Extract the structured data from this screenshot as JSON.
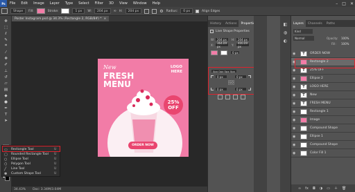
{
  "menubar": {
    "logo": "Ps",
    "items": [
      "File",
      "Edit",
      "Image",
      "Layer",
      "Type",
      "Select",
      "Filter",
      "3D",
      "View",
      "Window",
      "Help"
    ]
  },
  "options": {
    "shape": "Shape",
    "fill": "Fill:",
    "stroke": "Stroke:",
    "stroke_size": "1 px",
    "w_label": "W:",
    "w_value": "204 px",
    "h_label": "H:",
    "h_value": "204 px",
    "radius_label": "Radius:",
    "radius_value": "0 px",
    "align_edges": "Align Edges"
  },
  "document": {
    "tab_label": "Poster Instagram.psd @ 34.3% (Rectangle 2, RGB/8#) *"
  },
  "artwork": {
    "new": "New",
    "fresh": "FRESH",
    "menu": "MENU",
    "logo_line1": "LOGO",
    "logo_line2": "HERE",
    "discount": "25%",
    "off": "OFF",
    "order_now": "ORDER NOW"
  },
  "status": {
    "zoom": "34.43%",
    "doc": "Doc: 3.34M/3.04M"
  },
  "tool_popup": [
    {
      "icon": "rect",
      "label": "Rectangle Tool",
      "key": "U"
    },
    {
      "icon": "rrect",
      "label": "Rounded Rectangle Tool",
      "key": "U"
    },
    {
      "icon": "ellipse",
      "label": "Ellipse Tool",
      "key": "U"
    },
    {
      "icon": "polygon",
      "label": "Polygon Tool",
      "key": "U"
    },
    {
      "icon": "line",
      "label": "Line Tool",
      "key": "U"
    },
    {
      "icon": "custom",
      "label": "Custom Shape Tool",
      "key": "U"
    }
  ],
  "panel": {
    "tabs": [
      "History",
      "Actions",
      "Properties"
    ],
    "title": "Live Shape Properties",
    "w": "204 px",
    "h": "204 px",
    "x": "364.09 px",
    "y": "400.09 px",
    "stroke": "0 px",
    "corner_summary": "0px 0px 0px 0px",
    "tl": "0 px",
    "tr": "0 px",
    "bl": "0 px",
    "br": "0 px"
  },
  "layers": {
    "tabs": [
      "Layers",
      "Channels",
      "Paths"
    ],
    "kind": "Kind",
    "mode": "Normal",
    "opacity_label": "Opacity:",
    "opacity": "100%",
    "fill_label": "Fill:",
    "fill": "100%",
    "items": [
      {
        "name": "ORDER NOW",
        "thumb": "T",
        "pink": false,
        "selected": false
      },
      {
        "name": "Rectangle 2",
        "thumb": "",
        "pink": true,
        "selected": true
      },
      {
        "name": "25% OFF",
        "thumb": "T",
        "pink": false,
        "selected": false
      },
      {
        "name": "Ellipse 2",
        "thumb": "",
        "pink": true,
        "selected": false
      },
      {
        "name": "LOGO HERE",
        "thumb": "T",
        "pink": false,
        "selected": false
      },
      {
        "name": "New",
        "thumb": "T",
        "pink": false,
        "selected": false
      },
      {
        "name": "FRESH MENU",
        "thumb": "T",
        "pink": false,
        "selected": false
      },
      {
        "name": "Rectangle 1",
        "thumb": "",
        "pink": false,
        "selected": false
      },
      {
        "name": "Image",
        "thumb": "",
        "pink": true,
        "selected": false
      },
      {
        "name": "Compound Shape",
        "thumb": "",
        "pink": false,
        "selected": false
      },
      {
        "name": "Ellipse 1",
        "thumb": "",
        "pink": false,
        "selected": false
      },
      {
        "name": "Compound Shape",
        "thumb": "",
        "pink": false,
        "selected": false
      },
      {
        "name": "Color Fill 1",
        "thumb": "",
        "pink": false,
        "selected": false
      }
    ]
  },
  "colors": {
    "highlight": "#e0222d",
    "poster_pink": "#f27ca7",
    "accent_pink": "#e9456f"
  }
}
